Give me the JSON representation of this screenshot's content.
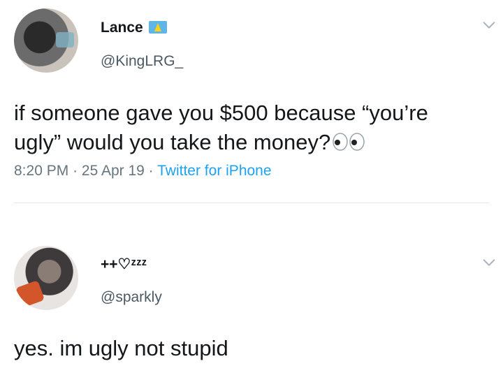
{
  "tweet": {
    "author_name": "Lance",
    "author_handle": "@KingLRG_",
    "text_line1": "if someone gave you $500 because “you’re",
    "text_line2": "ugly” would you take the money?",
    "time": "8:20 PM",
    "date": "25 Apr 19",
    "source": "Twitter for iPhone",
    "sep": "·"
  },
  "reply": {
    "author_name": "++♡ᶻᶻᶻ",
    "author_handle": "@sparkly",
    "text": "yes. im ugly not stupid"
  },
  "icons": {
    "flag": "saint-lucia-flag-icon",
    "chevron": "chevron-down-icon",
    "eyes": "eyes-emoji-icon"
  }
}
